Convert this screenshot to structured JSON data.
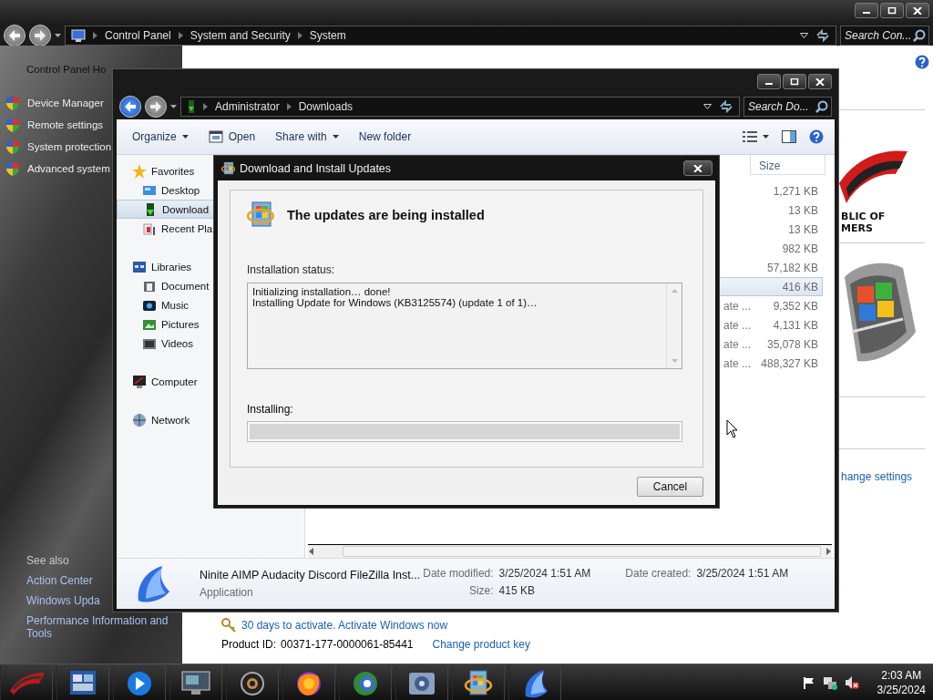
{
  "control_panel": {
    "address": {
      "crumbs": [
        "Control Panel",
        "System and Security",
        "System"
      ],
      "placeholder": "Search Con..."
    },
    "tasks": [
      {
        "label": "Control Panel Ho",
        "kind": "home"
      },
      {
        "label": "Device Manager",
        "kind": "shield"
      },
      {
        "label": "Remote settings",
        "kind": "shield"
      },
      {
        "label": "System protection",
        "kind": "shield"
      },
      {
        "label": "Advanced system",
        "kind": "shield"
      }
    ],
    "see_also": {
      "title": "See also",
      "links": [
        "Action Center",
        "Windows Upda",
        "Performance Information and Tools"
      ]
    },
    "logo_lines": [
      "BLIC OF",
      "MERS"
    ],
    "change_settings": "hange settings",
    "activation": "30 days to activate. Activate Windows now",
    "product_id_label": "Product ID:",
    "product_id": "00371-177-0000061-85441",
    "change_key": "Change product key"
  },
  "explorer": {
    "address": {
      "crumbs": [
        "Administrator",
        "Downloads"
      ],
      "placeholder": "Search Do..."
    },
    "toolbar": [
      {
        "label": "Organize",
        "kind": "menu"
      },
      {
        "label": "Open",
        "kind": "icon"
      },
      {
        "label": "Share with",
        "kind": "menu"
      },
      {
        "label": "New folder",
        "kind": "plain"
      }
    ],
    "nav": [
      {
        "label": "Favorites",
        "kind": "star",
        "selected": false,
        "children": [
          {
            "label": "Desktop",
            "kind": "desktop",
            "selected": false
          },
          {
            "label": "Download",
            "kind": "downloads",
            "selected": true
          },
          {
            "label": "Recent Pla",
            "kind": "recent",
            "selected": false
          }
        ]
      },
      {
        "label": "Libraries",
        "kind": "libraries",
        "selected": false,
        "children": [
          {
            "label": "Document",
            "kind": "documents",
            "selected": false
          },
          {
            "label": "Music",
            "kind": "music",
            "selected": false
          },
          {
            "label": "Pictures",
            "kind": "pictures",
            "selected": false
          },
          {
            "label": "Videos",
            "kind": "videos",
            "selected": false
          }
        ]
      },
      {
        "label": "Computer",
        "kind": "computer",
        "selected": false
      },
      {
        "label": "Network",
        "kind": "network",
        "selected": false
      }
    ],
    "size_header": "Size",
    "rows": [
      {
        "size": "1,271 KB",
        "selected": false
      },
      {
        "size": "13 KB",
        "selected": false
      },
      {
        "size": "13 KB",
        "selected": false
      },
      {
        "size": "982 KB",
        "selected": false
      },
      {
        "size": "57,182 KB",
        "selected": false
      },
      {
        "size": "416 KB",
        "selected": true
      },
      {
        "column_1": "ate ...",
        "size": "9,352 KB",
        "selected": false
      },
      {
        "column_1": "ate ...",
        "size": "4,131 KB",
        "selected": false
      },
      {
        "column_1": "ate ...",
        "size": "35,078 KB",
        "selected": false
      },
      {
        "column_1": "ate ...",
        "size": "488,327 KB",
        "selected": false
      }
    ],
    "details": {
      "name": "Ninite AIMP Audacity Discord FileZilla Inst...",
      "type": "Application",
      "fields": [
        {
          "label": "Date modified:",
          "value": "3/25/2024 1:51 AM"
        },
        {
          "label": "Size:",
          "value": "415 KB"
        },
        {
          "label": "Date created:",
          "value": "3/25/2024 1:51 AM"
        }
      ]
    }
  },
  "dialog": {
    "title": "Download and Install Updates",
    "heading": "The updates are being installed",
    "status_label": "Installation status:",
    "log": [
      "Initializing installation… done!",
      "Installing Update for Windows (KB3125574) (update 1 of 1)…"
    ],
    "progress_label": "Installing:",
    "progress": {
      "level": 0
    },
    "buttons": [
      "Cancel"
    ]
  },
  "taskbar": {
    "apps": [
      {
        "kind": "start"
      },
      {
        "kind": "tiles"
      },
      {
        "kind": "media"
      },
      {
        "kind": "monitor"
      },
      {
        "kind": "camera"
      },
      {
        "kind": "firefox"
      },
      {
        "kind": "globe"
      },
      {
        "kind": "gear"
      },
      {
        "kind": "update"
      },
      {
        "kind": "crystal"
      }
    ],
    "clock": {
      "time": "2:03 AM",
      "date": "3/25/2024"
    }
  }
}
